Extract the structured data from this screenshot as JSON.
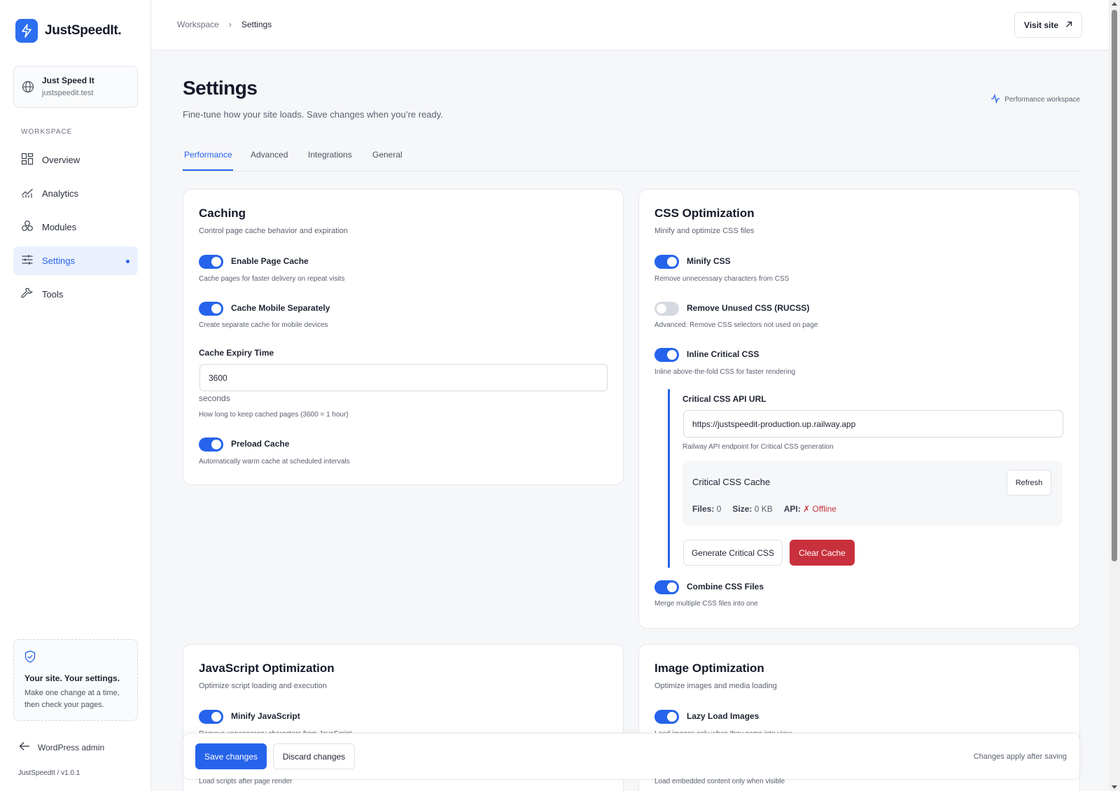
{
  "brand": {
    "name": "JustSpeedIt.",
    "accent": "#2563eb"
  },
  "site": {
    "name": "Just Speed It",
    "domain": "justspeedit.test"
  },
  "sidebar": {
    "section_label": "WORKSPACE",
    "items": [
      {
        "label": "Overview",
        "icon": "grid-icon"
      },
      {
        "label": "Analytics",
        "icon": "chart-icon"
      },
      {
        "label": "Modules",
        "icon": "modules-icon"
      },
      {
        "label": "Settings",
        "icon": "sliders-icon",
        "active": true
      },
      {
        "label": "Tools",
        "icon": "wrench-icon"
      }
    ],
    "tip": {
      "title": "Your site. Your settings.",
      "body": "Make one change at a time, then check your pages."
    },
    "wp_admin": "WordPress admin",
    "version": "JustSpeedIt / v1.0.1"
  },
  "topbar": {
    "breadcrumb": [
      "Workspace",
      "Settings"
    ],
    "visit_site": "Visit site"
  },
  "header": {
    "title": "Settings",
    "subtitle": "Fine-tune how your site loads. Save changes when you’re ready.",
    "workspace_badge": "Performance workspace"
  },
  "tabs": [
    "Performance",
    "Advanced",
    "Integrations",
    "General"
  ],
  "caching": {
    "title": "Caching",
    "subtitle": "Control page cache behavior and expiration",
    "options": [
      {
        "label": "Enable Page Cache",
        "desc": "Cache pages for faster delivery on repeat visits",
        "on": true
      },
      {
        "label": "Cache Mobile Separately",
        "desc": "Create separate cache for mobile devices",
        "on": true
      }
    ],
    "expiry": {
      "label": "Cache Expiry Time",
      "value": "3600",
      "unit": "seconds",
      "help": "How long to keep cached pages (3600 = 1 hour)"
    },
    "preload": {
      "label": "Preload Cache",
      "desc": "Automatically warm cache at scheduled intervals",
      "on": true
    }
  },
  "css": {
    "title": "CSS Optimization",
    "subtitle": "Minify and optimize CSS files",
    "options": [
      {
        "label": "Minify CSS",
        "desc": "Remove unnecessary characters from CSS",
        "on": true
      },
      {
        "label": "Remove Unused CSS (RUCSS)",
        "desc": "Advanced: Remove CSS selectors not used on page",
        "on": false
      },
      {
        "label": "Inline Critical CSS",
        "desc": "Inline above-the-fold CSS for faster rendering",
        "on": true
      }
    ],
    "api": {
      "label": "Critical CSS API URL",
      "value": "https://justspeedit-production.up.railway.app",
      "help": "Railway API endpoint for Critical CSS generation"
    },
    "cache": {
      "title": "Critical CSS Cache",
      "refresh": "Refresh",
      "files_label": "Files:",
      "files": "0",
      "size_label": "Size:",
      "size": "0 KB",
      "api_label": "API:",
      "api_status": "✗ Offline"
    },
    "generate": "Generate Critical CSS",
    "clear": "Clear Cache",
    "combine": {
      "label": "Combine CSS Files",
      "desc": "Merge multiple CSS files into one",
      "on": true
    }
  },
  "js": {
    "title": "JavaScript Optimization",
    "subtitle": "Optimize script loading and execution",
    "minify": {
      "label": "Minify JavaScript",
      "desc": "Remove unnecessary characters from JavaScript",
      "on": true
    },
    "peek": "Load scripts after page render"
  },
  "images": {
    "title": "Image Optimization",
    "subtitle": "Optimize images and media loading",
    "lazy": {
      "label": "Lazy Load Images",
      "desc": "Load images only when they come into view",
      "on": true
    },
    "peek": "Load embedded content only when visible"
  },
  "savebar": {
    "save": "Save changes",
    "discard": "Discard changes",
    "note": "Changes apply after saving"
  }
}
